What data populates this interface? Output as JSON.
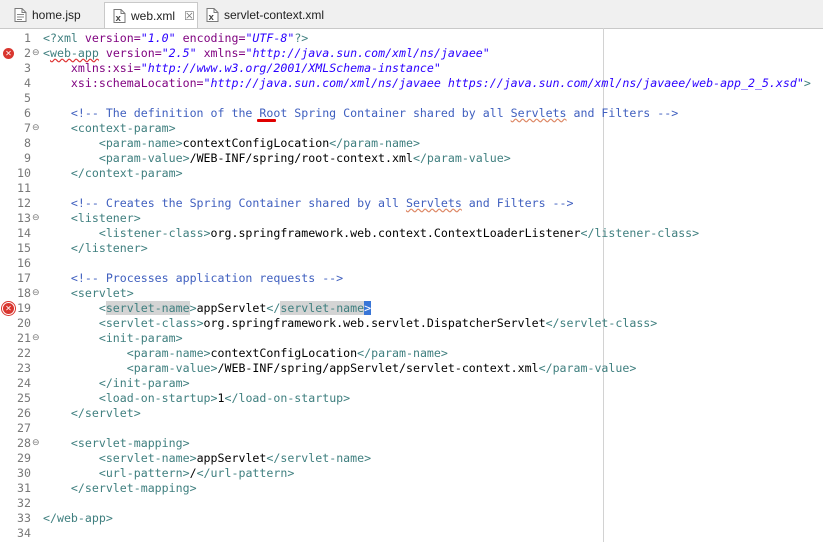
{
  "tabs": [
    {
      "label": "home.jsp",
      "icon": "jsp-file-icon",
      "active": false
    },
    {
      "label": "web.xml",
      "icon": "xml-file-icon",
      "active": true,
      "close": "☒"
    },
    {
      "label": "servlet-context.xml",
      "icon": "xml-file-icon",
      "active": false
    }
  ],
  "colors": {
    "tag": "#3f7f7f",
    "attr": "#7f007f",
    "value": "#2a00ff",
    "comment": "#3f5fbf",
    "error": "#d9362f",
    "selection": "#3875d7"
  },
  "markers": {
    "line2": "2"
  },
  "lines": [
    {
      "n": "1",
      "fold": "",
      "tokens": [
        [
          "tag",
          "<?xml "
        ],
        [
          "attr",
          "version="
        ],
        [
          "val",
          "\"1.0\""
        ],
        [
          "txt",
          " "
        ],
        [
          "attr",
          "encoding="
        ],
        [
          "val",
          "\"UTF-8\""
        ],
        [
          "tag",
          "?>"
        ]
      ]
    },
    {
      "n": "2",
      "fold": "⊖",
      "marker": "error-count",
      "tokens": [
        [
          "tag",
          "<"
        ],
        [
          "tag-err",
          "web-app"
        ],
        [
          "txt",
          " "
        ],
        [
          "attr",
          "version="
        ],
        [
          "val",
          "\"2.5\""
        ],
        [
          "txt",
          " "
        ],
        [
          "attr",
          "xmlns="
        ],
        [
          "val",
          "\"http://java.sun.com/xml/ns/javaee\""
        ]
      ]
    },
    {
      "n": "3",
      "fold": "",
      "tokens": [
        [
          "txt",
          "    "
        ],
        [
          "attr",
          "xmlns:xsi="
        ],
        [
          "val",
          "\"http://www.w3.org/2001/XMLSchema-instance\""
        ]
      ]
    },
    {
      "n": "4",
      "fold": "",
      "tokens": [
        [
          "txt",
          "    "
        ],
        [
          "attr",
          "xsi:schemaLocation="
        ],
        [
          "val",
          "\"http://java.sun.com/xml/ns/javaee https://java.sun.com/xml/ns/javaee/web-app_2_5.xsd\""
        ],
        [
          "tag",
          ">"
        ]
      ]
    },
    {
      "n": "5",
      "fold": "",
      "tokens": []
    },
    {
      "n": "6",
      "fold": "",
      "tokens": [
        [
          "txt",
          "    "
        ],
        [
          "com",
          "<!-- The definition of the Root Spring Container shared by all "
        ],
        [
          "com-spell",
          "Servlets"
        ],
        [
          "com",
          " and Filters -->"
        ]
      ]
    },
    {
      "n": "7",
      "fold": "⊖",
      "tokens": [
        [
          "txt",
          "    "
        ],
        [
          "tag",
          "<context-param>"
        ]
      ]
    },
    {
      "n": "8",
      "fold": "",
      "tokens": [
        [
          "txt",
          "        "
        ],
        [
          "tag",
          "<param-name>"
        ],
        [
          "txt",
          "contextConfigLocation"
        ],
        [
          "tag",
          "</param-name>"
        ]
      ]
    },
    {
      "n": "9",
      "fold": "",
      "tokens": [
        [
          "txt",
          "        "
        ],
        [
          "tag",
          "<param-value>"
        ],
        [
          "txt",
          "/WEB-INF/spring/root-context.xml"
        ],
        [
          "tag",
          "</param-value>"
        ]
      ]
    },
    {
      "n": "10",
      "fold": "",
      "tokens": [
        [
          "txt",
          "    "
        ],
        [
          "tag",
          "</context-param>"
        ]
      ]
    },
    {
      "n": "11",
      "fold": "",
      "tokens": []
    },
    {
      "n": "12",
      "fold": "",
      "tokens": [
        [
          "txt",
          "    "
        ],
        [
          "com",
          "<!-- Creates the Spring Container shared by all "
        ],
        [
          "com-spell",
          "Servlets"
        ],
        [
          "com",
          " and Filters -->"
        ]
      ]
    },
    {
      "n": "13",
      "fold": "⊖",
      "tokens": [
        [
          "txt",
          "    "
        ],
        [
          "tag",
          "<listener>"
        ]
      ]
    },
    {
      "n": "14",
      "fold": "",
      "tokens": [
        [
          "txt",
          "        "
        ],
        [
          "tag",
          "<listener-class>"
        ],
        [
          "txt",
          "org.springframework.web.context.ContextLoaderListener"
        ],
        [
          "tag",
          "</listener-class>"
        ]
      ]
    },
    {
      "n": "15",
      "fold": "",
      "tokens": [
        [
          "txt",
          "    "
        ],
        [
          "tag",
          "</listener>"
        ]
      ]
    },
    {
      "n": "16",
      "fold": "",
      "tokens": []
    },
    {
      "n": "17",
      "fold": "",
      "tokens": [
        [
          "txt",
          "    "
        ],
        [
          "com",
          "<!-- Processes application requests -->"
        ]
      ]
    },
    {
      "n": "18",
      "fold": "⊖",
      "tokens": [
        [
          "txt",
          "    "
        ],
        [
          "tag",
          "<servlet>"
        ]
      ]
    },
    {
      "n": "19",
      "fold": "",
      "marker": "error-boxed",
      "tokens": [
        [
          "txt",
          "        "
        ],
        [
          "tag",
          "<"
        ],
        [
          "tag-hl",
          "servlet-name"
        ],
        [
          "tag",
          ">"
        ],
        [
          "txt",
          "appServlet"
        ],
        [
          "tag",
          "</"
        ],
        [
          "tag-hl",
          "servlet-name"
        ],
        [
          "sel",
          ">"
        ]
      ]
    },
    {
      "n": "20",
      "fold": "",
      "tokens": [
        [
          "txt",
          "        "
        ],
        [
          "tag",
          "<servlet-class>"
        ],
        [
          "txt",
          "org.springframework.web.servlet.DispatcherServlet"
        ],
        [
          "tag",
          "</servlet-class>"
        ]
      ]
    },
    {
      "n": "21",
      "fold": "⊖",
      "tokens": [
        [
          "txt",
          "        "
        ],
        [
          "tag",
          "<init-param>"
        ]
      ]
    },
    {
      "n": "22",
      "fold": "",
      "tokens": [
        [
          "txt",
          "            "
        ],
        [
          "tag",
          "<param-name>"
        ],
        [
          "txt",
          "contextConfigLocation"
        ],
        [
          "tag",
          "</param-name>"
        ]
      ]
    },
    {
      "n": "23",
      "fold": "",
      "tokens": [
        [
          "txt",
          "            "
        ],
        [
          "tag",
          "<param-value>"
        ],
        [
          "txt",
          "/WEB-INF/spring/appServlet/servlet-context.xml"
        ],
        [
          "tag",
          "</param-value>"
        ]
      ]
    },
    {
      "n": "24",
      "fold": "",
      "tokens": [
        [
          "txt",
          "        "
        ],
        [
          "tag",
          "</init-param>"
        ]
      ]
    },
    {
      "n": "25",
      "fold": "",
      "tokens": [
        [
          "txt",
          "        "
        ],
        [
          "tag",
          "<load-on-startup>"
        ],
        [
          "txt",
          "1"
        ],
        [
          "tag",
          "</load-on-startup>"
        ]
      ]
    },
    {
      "n": "26",
      "fold": "",
      "tokens": [
        [
          "txt",
          "    "
        ],
        [
          "tag",
          "</servlet>"
        ]
      ]
    },
    {
      "n": "27",
      "fold": "",
      "tokens": []
    },
    {
      "n": "28",
      "fold": "⊖",
      "tokens": [
        [
          "txt",
          "    "
        ],
        [
          "tag",
          "<servlet-mapping>"
        ]
      ]
    },
    {
      "n": "29",
      "fold": "",
      "tokens": [
        [
          "txt",
          "        "
        ],
        [
          "tag",
          "<servlet-name>"
        ],
        [
          "txt",
          "appServlet"
        ],
        [
          "tag",
          "</servlet-name>"
        ]
      ]
    },
    {
      "n": "30",
      "fold": "",
      "tokens": [
        [
          "txt",
          "        "
        ],
        [
          "tag",
          "<url-pattern>"
        ],
        [
          "txt",
          "/"
        ],
        [
          "tag",
          "</url-pattern>"
        ]
      ]
    },
    {
      "n": "31",
      "fold": "",
      "tokens": [
        [
          "txt",
          "    "
        ],
        [
          "tag",
          "</servlet-mapping>"
        ]
      ]
    },
    {
      "n": "32",
      "fold": "",
      "tokens": []
    },
    {
      "n": "33",
      "fold": "",
      "tokens": [
        [
          "tag",
          "</web-app>"
        ]
      ]
    },
    {
      "n": "34",
      "fold": "",
      "tokens": []
    }
  ]
}
